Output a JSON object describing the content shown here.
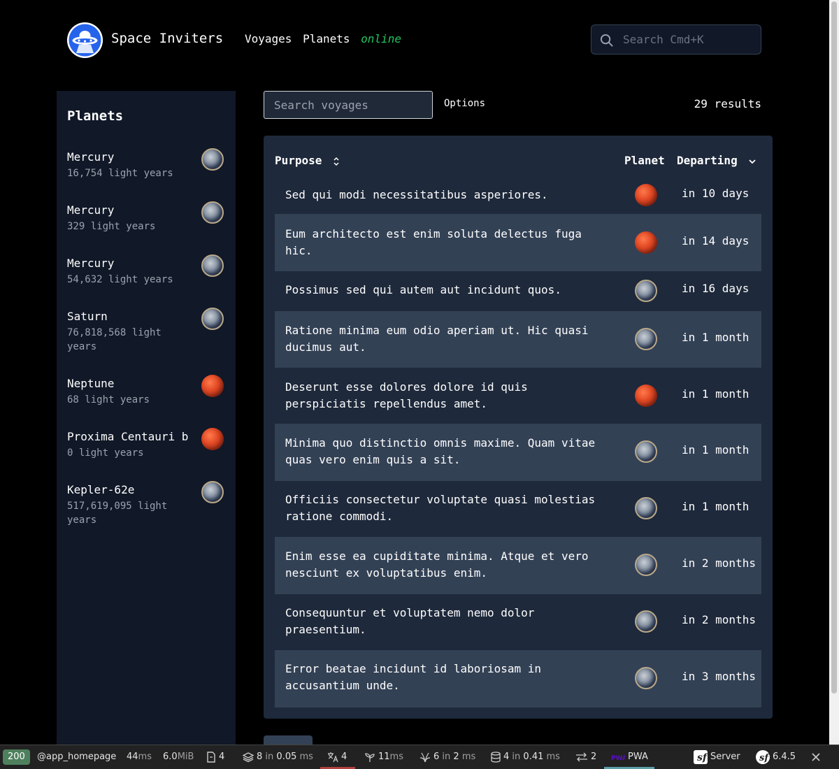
{
  "header": {
    "brand": "Space Inviters",
    "nav": [
      {
        "label": "Voyages"
      },
      {
        "label": "Planets"
      }
    ],
    "status": "online",
    "search_placeholder": "Search Cmd+K",
    "accent_color": "#22c55e"
  },
  "sidebar": {
    "title": "Planets",
    "planets": [
      {
        "name": "Mercury",
        "distance": "16,754 light years",
        "icon": "earth-planet-icon"
      },
      {
        "name": "Mercury",
        "distance": "329 light years",
        "icon": "earth-planet-icon"
      },
      {
        "name": "Mercury",
        "distance": "54,632 light years",
        "icon": "earth-planet-icon"
      },
      {
        "name": "Saturn",
        "distance": "76,818,568 light years",
        "icon": "earth-planet-icon"
      },
      {
        "name": "Neptune",
        "distance": "68 light years",
        "icon": "mars-planet-icon"
      },
      {
        "name": "Proxima Centauri b",
        "distance": "0 light years",
        "icon": "mars-planet-icon"
      },
      {
        "name": "Kepler-62e",
        "distance": "517,619,095 light years",
        "icon": "earth-planet-icon"
      }
    ]
  },
  "main": {
    "search_placeholder": "Search voyages",
    "options_label": "Options",
    "results": "29 results",
    "columns": {
      "purpose": "Purpose",
      "planet": "Planet",
      "departing": "Departing"
    },
    "rows": [
      {
        "purpose": "Sed qui modi necessitatibus asperiores.",
        "planet": "mars-planet-icon",
        "departing": "in 10 days"
      },
      {
        "purpose": "Eum architecto est enim soluta delectus fuga hic.",
        "planet": "mars-planet-icon",
        "departing": "in 14 days"
      },
      {
        "purpose": "Possimus sed qui autem aut incidunt quos.",
        "planet": "earth-planet-icon",
        "departing": "in 16 days"
      },
      {
        "purpose": "Ratione minima eum odio aperiam ut. Hic quasi ducimus aut.",
        "planet": "earth-planet-icon",
        "departing": "in 1 month"
      },
      {
        "purpose": "Deserunt esse dolores dolore id quis perspiciatis repellendus amet.",
        "planet": "mars-planet-icon",
        "departing": "in 1 month"
      },
      {
        "purpose": "Minima quo distinctio omnis maxime. Quam vitae quas vero enim quis a sit.",
        "planet": "earth-planet-icon",
        "departing": "in 1 month"
      },
      {
        "purpose": "Officiis consectetur voluptate quasi molestias ratione commodi.",
        "planet": "earth-planet-icon",
        "departing": "in 1 month"
      },
      {
        "purpose": "Enim esse ea cupiditate minima. Atque et vero nesciunt ex voluptatibus enim.",
        "planet": "earth-planet-icon",
        "departing": "in 2 months"
      },
      {
        "purpose": "Consequuntur et voluptatem nemo dolor praesentium.",
        "planet": "earth-planet-icon",
        "departing": "in 2 months"
      },
      {
        "purpose": "Error beatae incidunt id laboriosam in accusantium unde.",
        "planet": "earth-planet-icon",
        "departing": "in 3 months"
      }
    ]
  },
  "toolbar": {
    "status_code": "200",
    "route": "@app_homepage",
    "time_value": "44",
    "time_unit": "ms",
    "memory_value": "6.0",
    "memory_unit": "MiB",
    "forms_count": "4",
    "cache_count": "8",
    "cache_in": "in",
    "cache_time": "0.05",
    "cache_unit": "ms",
    "translation_count": "4",
    "stimulus_time": "11",
    "stimulus_unit": "ms",
    "twig_count": "6",
    "twig_in": "in",
    "twig_value": "2",
    "twig_unit": "ms",
    "db_count": "4",
    "db_in": "in",
    "db_time": "0.41",
    "db_unit": "ms",
    "http_count": "2",
    "pwa_label": "PWA",
    "server_label": "Server",
    "symfony_version": "6.4.5",
    "status_color": "#4f805d"
  }
}
